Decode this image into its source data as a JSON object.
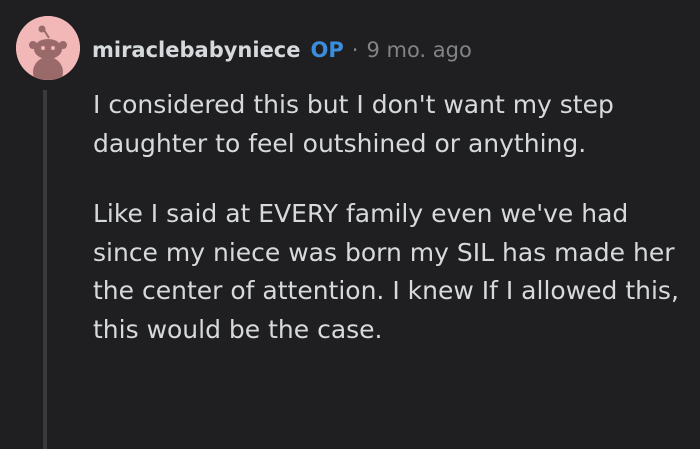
{
  "comment": {
    "author": "miraclebabyniece",
    "op_badge": "OP",
    "separator": "·",
    "timestamp": "9 mo. ago",
    "avatar_icon": "reddit-snoo-avatar-icon",
    "colors": {
      "background": "#1f1f21",
      "text": "#d7dadc",
      "op": "#3a8ddc",
      "meta": "#818384",
      "avatar_bg": "#f2b8b8",
      "avatar_figure": "#9a6a6a"
    },
    "paragraphs": [
      "I considered this but I don't want my step daughter to feel outshined or anything.",
      "Like I said at EVERY family even we've had since my niece was born my SIL has made her the center of attention. I knew If I allowed this, this would be the case."
    ]
  }
}
